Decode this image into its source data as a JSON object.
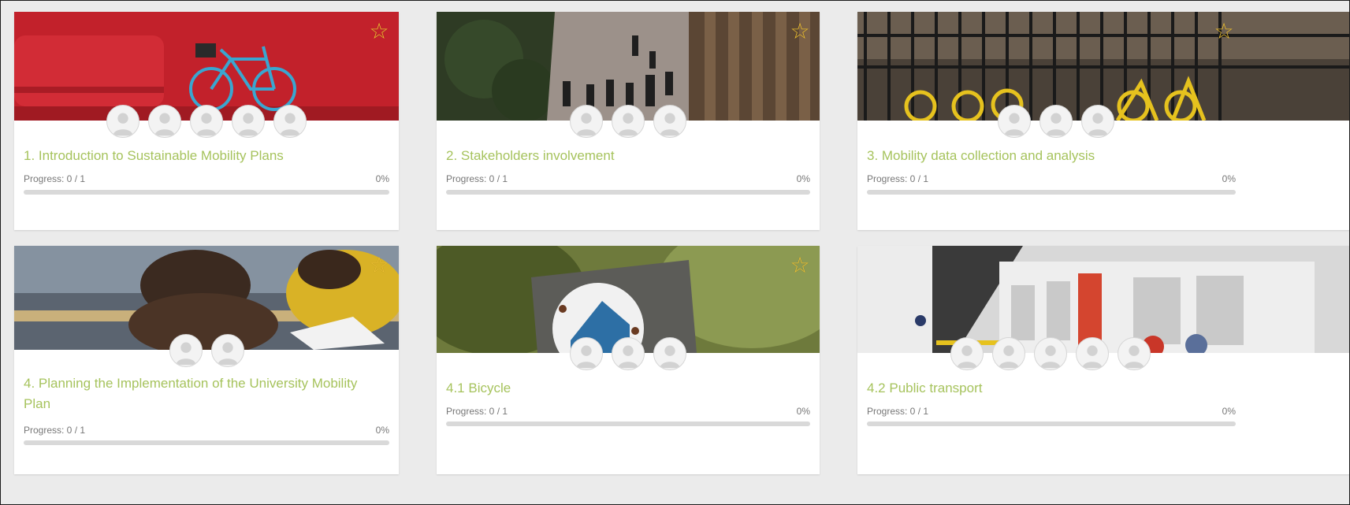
{
  "courses": [
    {
      "title": "1. Introduction to Sustainable Mobility Plans",
      "progress_label": "Progress: 0 / 1",
      "percent_label": "0%",
      "progress": 0,
      "avatar_count": 5
    },
    {
      "title": "2. Stakeholders involvement",
      "progress_label": "Progress: 0 / 1",
      "percent_label": "0%",
      "progress": 0,
      "avatar_count": 3
    },
    {
      "title": "3. Mobility data collection and analysis",
      "progress_label": "Progress: 0 / 1",
      "percent_label": "0%",
      "progress": 0,
      "avatar_count": 3
    },
    {
      "title": "4. Planning the Implementation of the University Mobility Plan",
      "progress_label": "Progress: 0 / 1",
      "percent_label": "0%",
      "progress": 0,
      "avatar_count": 2
    },
    {
      "title": "4.1 Bicycle",
      "progress_label": "Progress: 0 / 1",
      "percent_label": "0%",
      "progress": 0,
      "avatar_count": 3
    },
    {
      "title": "4.2 Public transport",
      "progress_label": "Progress: 0 / 1",
      "percent_label": "0%",
      "progress": 0,
      "avatar_count": 5
    }
  ],
  "icons": {
    "favorite": "star-outline-icon",
    "avatar": "user-avatar-icon"
  },
  "colors": {
    "title": "#a6c35d",
    "star": "#f0c232",
    "bar_track": "#d9d9d9",
    "background": "#ebebeb"
  }
}
